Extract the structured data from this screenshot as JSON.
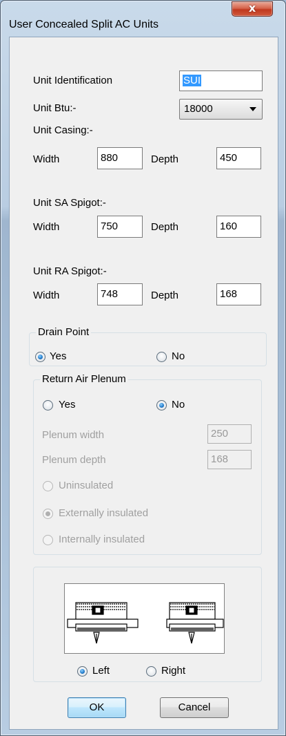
{
  "window": {
    "title": "User Concealed Split AC Units",
    "close_glyph": "x"
  },
  "unit_identification": {
    "label": "Unit Identification",
    "value": "SUI"
  },
  "unit_btu": {
    "label": "Unit Btu:-",
    "selected": "18000"
  },
  "unit_casing": {
    "label": "Unit Casing:-",
    "width_label": "Width",
    "width": "880",
    "depth_label": "Depth",
    "depth": "450"
  },
  "sa_spigot": {
    "label": "Unit SA Spigot:-",
    "width_label": "Width",
    "width": "750",
    "depth_label": "Depth",
    "depth": "160"
  },
  "ra_spigot": {
    "label": "Unit RA Spigot:-",
    "width_label": "Width",
    "width": "748",
    "depth_label": "Depth",
    "depth": "168"
  },
  "drain_point": {
    "legend": "Drain Point",
    "yes": "Yes",
    "no": "No",
    "selected": "Yes"
  },
  "return_air_plenum": {
    "legend": "Return Air Plenum",
    "yes": "Yes",
    "no": "No",
    "selected": "No",
    "plenum_width_label": "Plenum width",
    "plenum_width": "250",
    "plenum_depth_label": "Plenum depth",
    "plenum_depth": "168",
    "uninsulated": "Uninsulated",
    "externally_insulated": "Externally insulated",
    "internally_insulated": "Internally insulated",
    "insulation_selected": "Externally insulated"
  },
  "orientation": {
    "left": "Left",
    "right": "Right",
    "selected": "Left"
  },
  "buttons": {
    "ok": "OK",
    "cancel": "Cancel"
  },
  "colors": {
    "accent": "#3399ff",
    "radio_dot": "#1f78c8",
    "close_button": "#c0391f"
  }
}
